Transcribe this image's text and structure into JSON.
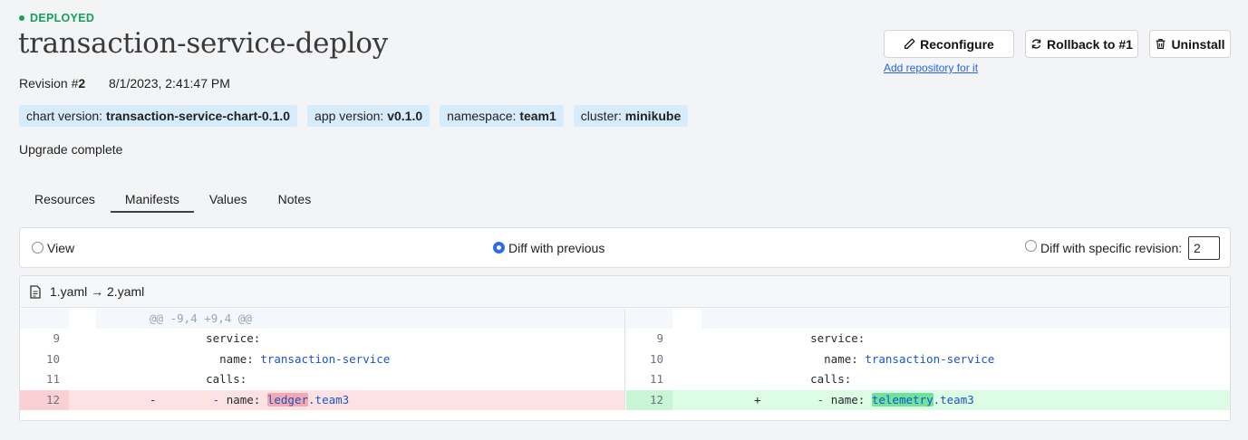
{
  "status": {
    "label": "DEPLOYED",
    "color": "#14a05a"
  },
  "title": "transaction-service-deploy",
  "revision": {
    "label": "Revision #",
    "number": "2",
    "date": "8/1/2023, 2:41:47 PM"
  },
  "badges": [
    {
      "label": "chart version: ",
      "value": "transaction-service-chart-0.1.0"
    },
    {
      "label": "app version: ",
      "value": "v0.1.0"
    },
    {
      "label": "namespace: ",
      "value": "team1"
    },
    {
      "label": "cluster: ",
      "value": "minikube"
    }
  ],
  "description": "Upgrade complete",
  "actions": {
    "reconfigure": "Reconfigure",
    "rollback": "Rollback to #1",
    "uninstall": "Uninstall",
    "add_repo": "Add repository for it"
  },
  "tabs": [
    {
      "label": "Resources",
      "active": false
    },
    {
      "label": "Manifests",
      "active": true
    },
    {
      "label": "Values",
      "active": false
    },
    {
      "label": "Notes",
      "active": false
    }
  ],
  "diff_options": {
    "view": "View",
    "diff_previous": "Diff with previous",
    "diff_specific": "Diff with specific revision:",
    "revision_value": "2",
    "selected": "diff_previous"
  },
  "diff": {
    "file_header": "1.yaml → 2.yaml",
    "hunk": "@@ -9,4 +9,4 @@",
    "left": [
      {
        "ln": "9",
        "indent": "    ",
        "key": "service:",
        "val": "",
        "type": "ctx"
      },
      {
        "ln": "10",
        "indent": "      ",
        "key": "name: ",
        "val": "transaction-service",
        "type": "ctx"
      },
      {
        "ln": "11",
        "indent": "    ",
        "key": "calls:",
        "val": "",
        "type": "ctx"
      },
      {
        "ln": "12",
        "marker": "-",
        "indent": "     ",
        "key": "- name: ",
        "hl": "ledger",
        "val": ".team3",
        "type": "del"
      }
    ],
    "right": [
      {
        "ln": "9",
        "indent": "    ",
        "key": "service:",
        "val": "",
        "type": "ctx"
      },
      {
        "ln": "10",
        "indent": "      ",
        "key": "name: ",
        "val": "transaction-service",
        "type": "ctx"
      },
      {
        "ln": "11",
        "indent": "    ",
        "key": "calls:",
        "val": "",
        "type": "ctx"
      },
      {
        "ln": "12",
        "marker": "+",
        "indent": "     ",
        "key": "- name: ",
        "hl": "telemetry",
        "val": ".team3",
        "type": "add"
      }
    ],
    "colors": {
      "del_bg": "#fde2e4",
      "del_ln_bg": "#fbd0d4",
      "add_bg": "#dcfce4",
      "add_ln_bg": "#c8f5d4"
    }
  }
}
